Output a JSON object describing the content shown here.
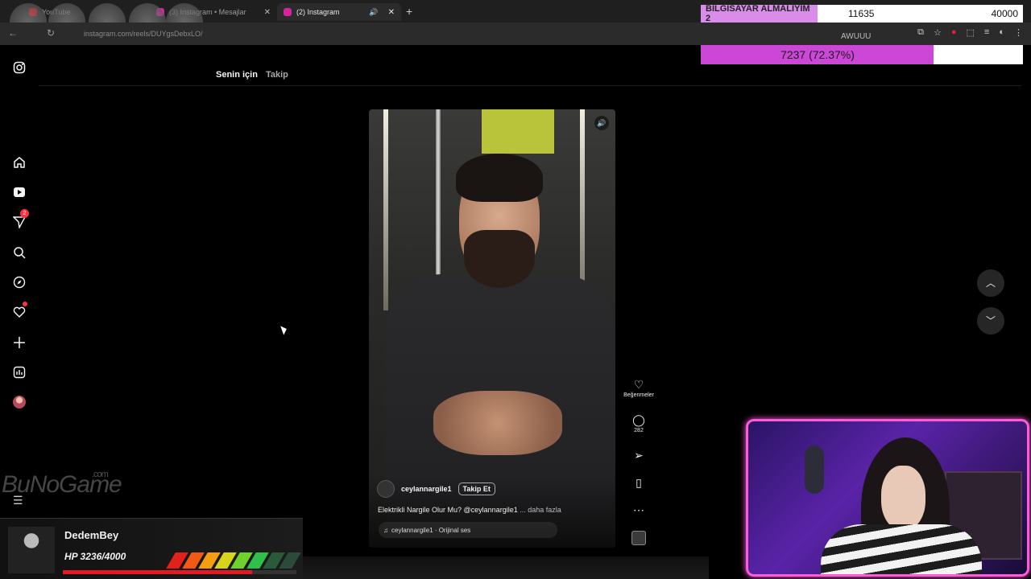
{
  "browser": {
    "tabs": [
      {
        "title": "YouTube",
        "fav_color": "#ff0000"
      },
      {
        "title": "(3) Instagram • Mesajlar",
        "fav_color": "#d6249f"
      },
      {
        "title": "(2) Instagram",
        "fav_color": "#d6249f"
      }
    ],
    "new_tab": "+",
    "url": "instagram.com/reels/DUYgsDebxLO/"
  },
  "donation_goal": {
    "label": "BİLGİSAYAR ALMALIYIM 2",
    "current": "11635",
    "target": "40000",
    "progress_text": "7237 (72.37%)",
    "progress_fraction": 0.7237,
    "overlay_text": "AWUUU"
  },
  "instagram": {
    "feed_tabs": {
      "for_you": "Senin için",
      "following": "Takip"
    },
    "notification_count": "2",
    "reel": {
      "author": "ceylannargile1",
      "follow_label": "Takip Et",
      "caption": "Elektrikli Nargile Olur Mu? @ceylannargile1",
      "caption_more": "... daha fazla",
      "audio": "ceylannargile1 · Orijinal ses"
    },
    "actions": {
      "like_label": "Beğenmeler",
      "comment_count": "282"
    }
  },
  "stream": {
    "watermark": "BuNoGame",
    "watermark_suffix": ".com",
    "subscriber": {
      "name": "DedemBey",
      "hp_text": "HP 3236/4000",
      "hp_fraction": 0.809
    }
  },
  "colors": {
    "accent_pink": "#cc46d8",
    "cam_border": "#ff5ad9",
    "notification_red": "#ff3040"
  }
}
